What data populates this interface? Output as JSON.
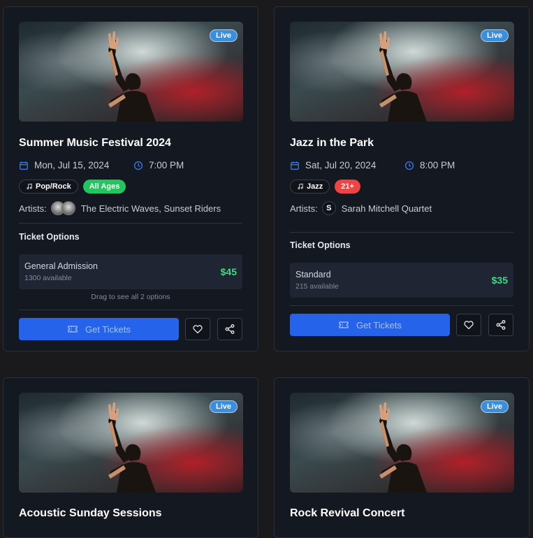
{
  "events": [
    {
      "badge": "Live",
      "title": "Summer Music Festival 2024",
      "date": "Mon, Jul 15, 2024",
      "time": "7:00 PM",
      "genre": "Pop/Rock",
      "age": "All Ages",
      "age_color": "#22c55e",
      "artists_label": "Artists:",
      "artists": "The Electric Waves, Sunset Riders",
      "tickets_heading": "Ticket Options",
      "ticket": {
        "name": "General Admission",
        "available": "1300 available",
        "price": "$45"
      },
      "drag_hint": "Drag to see all 2 options",
      "cta": "Get Tickets"
    },
    {
      "badge": "Live",
      "title": "Jazz in the Park",
      "date": "Sat, Jul 20, 2024",
      "time": "8:00 PM",
      "genre": "Jazz",
      "age": "21+",
      "age_color": "#ef4444",
      "artists_label": "Artists:",
      "avatar_letter": "S",
      "artists": "Sarah Mitchell Quartet",
      "tickets_heading": "Ticket Options",
      "ticket": {
        "name": "Standard",
        "available": "215 available",
        "price": "$35"
      },
      "cta": "Get Tickets"
    },
    {
      "badge": "Live",
      "title": "Acoustic Sunday Sessions"
    },
    {
      "badge": "Live",
      "title": "Rock Revival Concert"
    }
  ],
  "icons": {
    "date": "calendar-icon",
    "time": "clock-icon",
    "genre": "music-note-icon",
    "ticket": "ticket-icon",
    "favorite": "heart-icon",
    "share": "share-icon"
  },
  "colors": {
    "accent": "#2563eb",
    "price": "#3ddc84",
    "live": "#3a8edc"
  }
}
